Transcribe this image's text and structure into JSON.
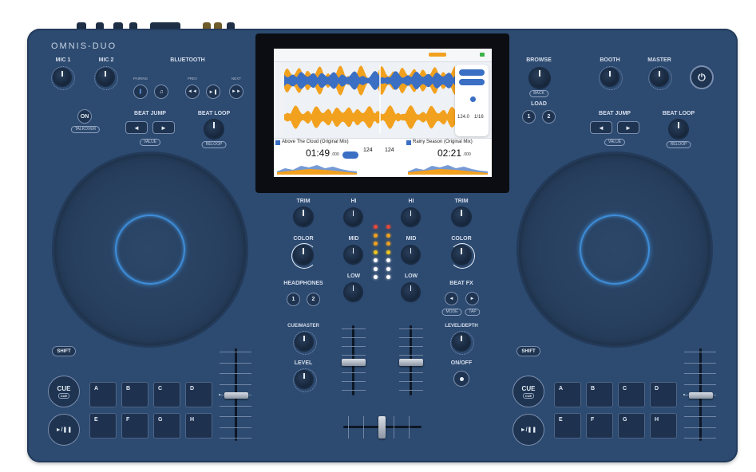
{
  "device": {
    "brand": "OMNIS-DUO"
  },
  "left": {
    "mic1": "MIC 1",
    "mic2": "MIC 2",
    "bluetooth": "BLUETOOTH",
    "bt_sub_pairing": "PAIRING",
    "bt_sub_prev": "PREV",
    "bt_sub_next": "NEXT",
    "on_label": "ON",
    "talkover": "TALKOVER",
    "beat_jump": "BEAT JUMP",
    "value": "VALUE",
    "beat_loop": "BEAT LOOP",
    "reloop": "RELOOP",
    "shift": "SHIFT",
    "cue": "CUE",
    "cue_sub": "CUE",
    "play": "►/❚❚",
    "pads": [
      "A",
      "B",
      "C",
      "D",
      "E",
      "F",
      "G",
      "H"
    ]
  },
  "right": {
    "browse": "BROWSE",
    "back": "BACK",
    "load": "LOAD",
    "load1": "1",
    "load2": "2",
    "booth": "BOOTH",
    "master": "MASTER",
    "beat_jump": "BEAT JUMP",
    "value": "VALUE",
    "beat_loop": "BEAT LOOP",
    "reloop": "RELOOP",
    "shift": "SHIFT",
    "cue": "CUE",
    "cue_sub": "CUE",
    "play": "►/❚❚",
    "pads": [
      "A",
      "B",
      "C",
      "D",
      "E",
      "F",
      "G",
      "H"
    ]
  },
  "mixer": {
    "trim": "TRIM",
    "hi": "HI",
    "mid": "MID",
    "low": "LOW",
    "color": "COLOR",
    "headphones": "HEADPHONES",
    "hp1": "1",
    "hp2": "2",
    "cue_master": "CUE/MASTER",
    "level": "LEVEL",
    "beat_fx": "BEAT FX",
    "fx_mode": "MODE",
    "fx_tap": "TAP",
    "level_depth": "LEVEL/DEPTH",
    "on_off": "ON/OFF"
  },
  "screen": {
    "deck1_title": "Above The Cloud (Original Mix)",
    "deck1_time": "01:49",
    "deck1_ms": ".000",
    "deck1_bpm": "124",
    "deck2_title": "Rainy Season (Original Mix)",
    "deck2_time": "02:21",
    "deck2_ms": ".000",
    "deck2_bpm": "124",
    "deck2_bpm_detail": "124.0",
    "deck2_ratio": "1/16"
  },
  "colors": {
    "body": "#2d4a70",
    "accent_ring": "#3e8dd8",
    "wave_orange": "#f2a11f",
    "wave_blue": "#3a6fc4"
  }
}
